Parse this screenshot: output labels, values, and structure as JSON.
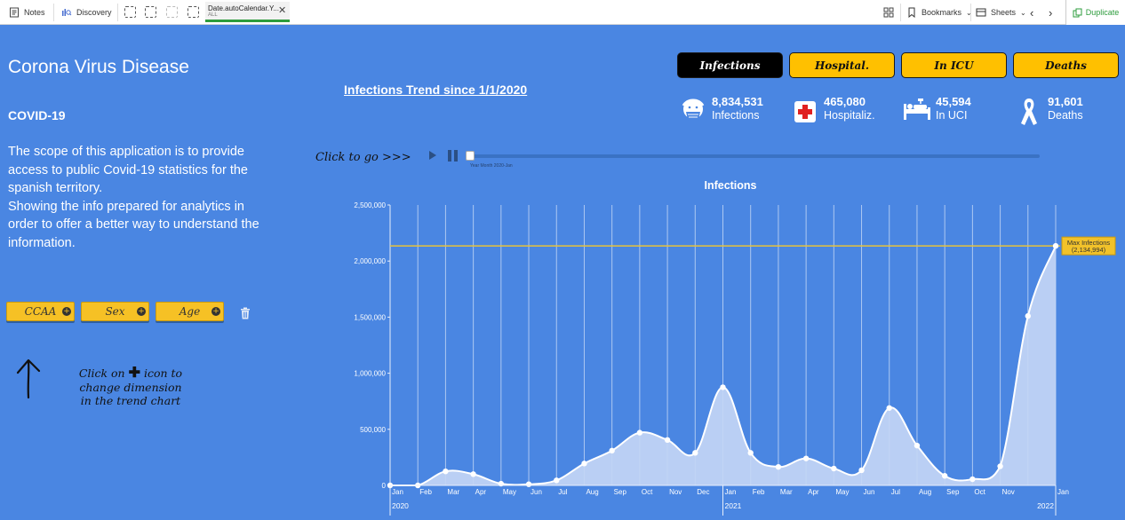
{
  "toolbar": {
    "notes": "Notes",
    "discovery": "Discovery",
    "tab_title": "Date.autoCalendar.Y...",
    "tab_sub": "ALL",
    "bookmarks": "Bookmarks",
    "sheets": "Sheets",
    "duplicate": "Duplicate"
  },
  "left": {
    "title": "Corona Virus Disease",
    "subtitle": "COVID-19",
    "desc1": "The scope of this application is to provide access to public Covid-19 statistics for the spanish territory.",
    "desc2": "Showing the info prepared for analytics in order to offer a better way to understand the information.",
    "dims": [
      "CCAA",
      "Sex",
      "Age"
    ],
    "hint_l1a": "Click on",
    "hint_l1b": "icon to",
    "hint_l2": "change dimension",
    "hint_l3": "in the trend chart"
  },
  "header": {
    "trend_title": "Infections Trend since 1/1/2020",
    "click_go": "Click to go >>>",
    "slider_label": "Year Month 2020-Jan"
  },
  "kpi_buttons": [
    "Infections",
    "Hospital.",
    "In ICU",
    "Deaths"
  ],
  "kpis": [
    {
      "value": "8,834,531",
      "label": "Infections",
      "icon": "masked-face-icon"
    },
    {
      "value": "465,080",
      "label": "Hospitaliz.",
      "icon": "red-cross-icon"
    },
    {
      "value": "45,594",
      "label": "In UCI",
      "icon": "hospital-bed-icon"
    },
    {
      "value": "91,601",
      "label": "Deaths",
      "icon": "awareness-ribbon-icon"
    }
  ],
  "colors": {
    "background": "#4a86e2",
    "active_button": "#000000",
    "inactive_button": "#ffc000",
    "area_fill": "#c3d6f5",
    "reference_line": "#e8c23a"
  },
  "chart_data": {
    "type": "area",
    "title": "Infections",
    "categories": [
      "Jan",
      "Feb",
      "Mar",
      "Apr",
      "May",
      "Jun",
      "Jul",
      "Aug",
      "Sep",
      "Oct",
      "Nov",
      "Dec",
      "Jan",
      "Feb",
      "Mar",
      "Apr",
      "May",
      "Jun",
      "Jul",
      "Aug",
      "Sep",
      "Oct",
      "Nov",
      "Jan"
    ],
    "values": [
      0,
      0,
      125000,
      100000,
      15000,
      10000,
      45000,
      195000,
      310000,
      470000,
      405000,
      290000,
      875000,
      290000,
      165000,
      240000,
      150000,
      135000,
      690000,
      355000,
      85000,
      55000,
      170000,
      1510000,
      2135000
    ],
    "year_labels": [
      {
        "label": "2020",
        "index": 0
      },
      {
        "label": "2021",
        "index": 12
      },
      {
        "label": "2022",
        "index": 24
      }
    ],
    "month_labels": [
      "Jan",
      "Feb",
      "Mar",
      "Apr",
      "May",
      "Jun",
      "Jul",
      "Aug",
      "Sep",
      "Oct",
      "Nov",
      "Dec",
      "Jan",
      "Feb",
      "Mar",
      "Apr",
      "May",
      "Jun",
      "Jul",
      "Aug",
      "Sep",
      "Oct",
      "Nov",
      "",
      "Jan"
    ],
    "y_ticks": [
      0,
      500000,
      1000000,
      1500000,
      2000000,
      2500000
    ],
    "y_tick_labels": [
      "0",
      "500,000",
      "1,000,000",
      "1,500,000",
      "2,000,000",
      "2,500,000"
    ],
    "ylim": [
      0,
      2500000
    ],
    "reference_line": {
      "value": 2134994,
      "label1": "Max Infections",
      "label2": "(2,134,994)"
    },
    "grid": true
  }
}
